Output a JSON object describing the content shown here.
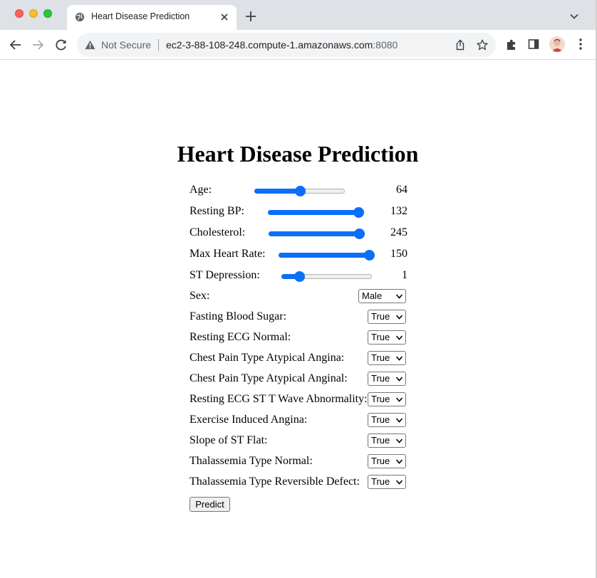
{
  "browser": {
    "tab_title": "Heart Disease Prediction",
    "security_label": "Not Secure",
    "url_host": "ec2-3-88-108-248.compute-1.amazonaws.com",
    "url_port": ":8080"
  },
  "page": {
    "title": "Heart Disease Prediction",
    "sliders": [
      {
        "label": "Age:",
        "value": "64",
        "fraction": 0.5
      },
      {
        "label": "Resting BP:",
        "value": "132",
        "fraction": 1.0
      },
      {
        "label": "Cholesterol:",
        "value": "245",
        "fraction": 1.0
      },
      {
        "label": "Max Heart Rate:",
        "value": "150",
        "fraction": 1.0
      },
      {
        "label": "ST Depression:",
        "value": "1",
        "fraction": 0.2
      }
    ],
    "selects": [
      {
        "label": "Sex:",
        "value": "Male"
      },
      {
        "label": "Fasting Blood Sugar:",
        "value": "True"
      },
      {
        "label": "Resting ECG Normal:",
        "value": "True"
      },
      {
        "label": "Chest Pain Type Atypical Angina:",
        "value": "True"
      },
      {
        "label": "Chest Pain Type Atypical Anginal:",
        "value": "True"
      },
      {
        "label": "Resting ECG ST T Wave Abnormality:",
        "value": "True"
      },
      {
        "label": "Exercise Induced Angina:",
        "value": "True"
      },
      {
        "label": "Slope of ST Flat:",
        "value": "True"
      },
      {
        "label": "Thalassemia Type Normal:",
        "value": "True"
      },
      {
        "label": "Thalassemia Type Reversible Defect:",
        "value": "True"
      }
    ],
    "predict_label": "Predict"
  },
  "colors": {
    "accent": "#0b6ef9"
  }
}
